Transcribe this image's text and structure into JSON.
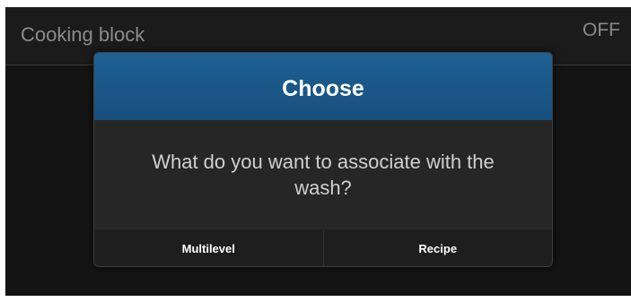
{
  "header": {
    "title": "Cooking block",
    "status": "OFF"
  },
  "dialog": {
    "title": "Choose",
    "message": "What do you want to associate with the wash?",
    "buttons": [
      "Multilevel",
      "Recipe"
    ]
  }
}
